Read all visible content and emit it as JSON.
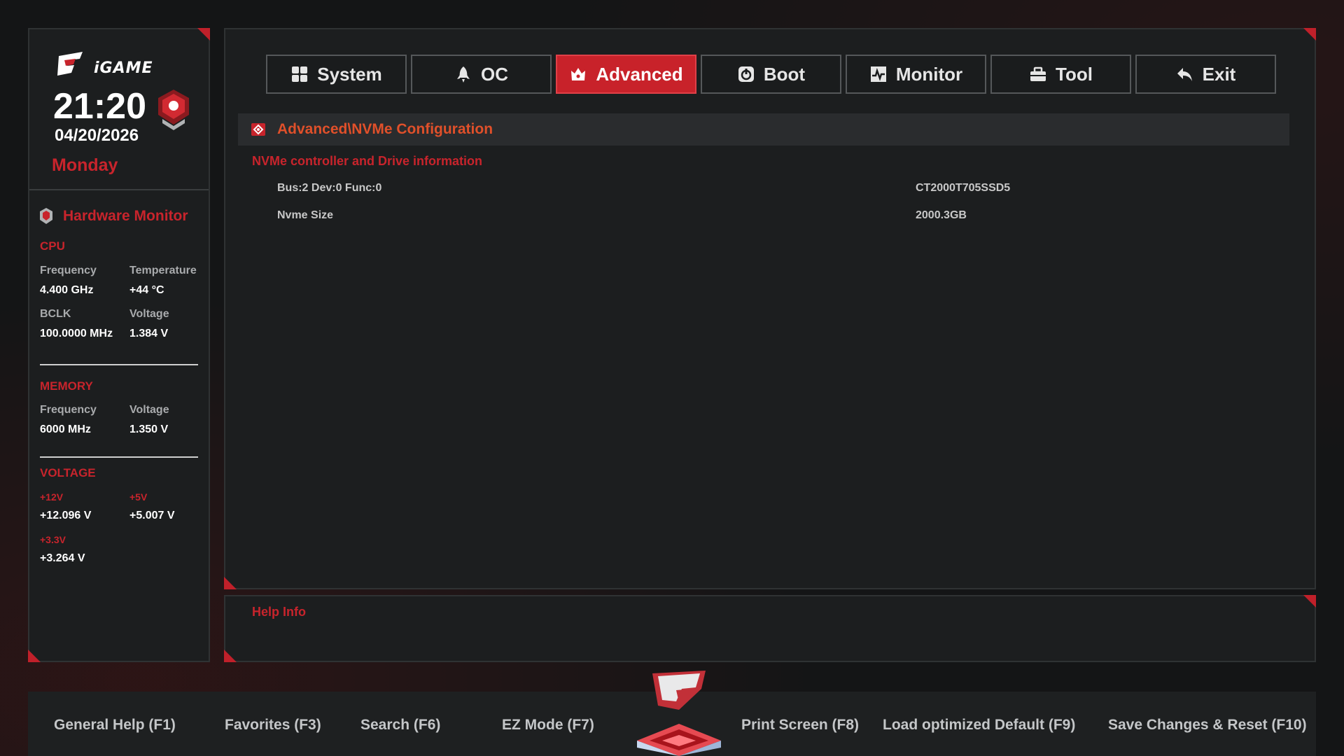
{
  "brand": {
    "logo_text": "iGAME"
  },
  "clock": {
    "time": "21:20",
    "date": "04/20/2026",
    "day": "Monday"
  },
  "hardware_monitor": {
    "title": "Hardware Monitor",
    "cpu": {
      "label": "CPU",
      "frequency_label": "Frequency",
      "frequency": "4.400 GHz",
      "temperature_label": "Temperature",
      "temperature": "+44 °C",
      "bclk_label": "BCLK",
      "bclk": "100.0000 MHz",
      "voltage_label": "Voltage",
      "voltage": "1.384 V"
    },
    "memory": {
      "label": "MEMORY",
      "frequency_label": "Frequency",
      "frequency": "6000 MHz",
      "voltage_label": "Voltage",
      "voltage": "1.350 V"
    },
    "voltage": {
      "label": "VOLTAGE",
      "v12_label": "+12V",
      "v12": "+12.096 V",
      "v5_label": "+5V",
      "v5": "+5.007 V",
      "v33_label": "+3.3V",
      "v33": "+3.264 V"
    }
  },
  "tabs": [
    {
      "label": "System",
      "icon": "grid-icon"
    },
    {
      "label": "OC",
      "icon": "rocket-icon"
    },
    {
      "label": "Advanced",
      "icon": "crown-icon",
      "active": true
    },
    {
      "label": "Boot",
      "icon": "power-icon"
    },
    {
      "label": "Monitor",
      "icon": "pulse-icon"
    },
    {
      "label": "Tool",
      "icon": "toolbox-icon"
    },
    {
      "label": "Exit",
      "icon": "back-arrow-icon"
    }
  ],
  "breadcrumb": "Advanced\\NVMe Configuration",
  "content": {
    "section_title": "NVMe controller and Drive information",
    "rows": [
      {
        "label": "Bus:2 Dev:0 Func:0",
        "value": "CT2000T705SSD5"
      },
      {
        "label": "Nvme Size",
        "value": "2000.3GB"
      }
    ]
  },
  "help": {
    "title": "Help Info"
  },
  "bottom_bar": {
    "general_help": "General Help (F1)",
    "favorites": "Favorites (F3)",
    "search": "Search (F6)",
    "ez_mode": "EZ Mode (F7)",
    "print_screen": "Print Screen (F8)",
    "load_default": "Load optimized Default (F9)",
    "save_reset": "Save Changes & Reset (F10)"
  },
  "colors": {
    "accent": "#c8242c",
    "path": "#e0502a",
    "panel": "#1c1e1f"
  }
}
